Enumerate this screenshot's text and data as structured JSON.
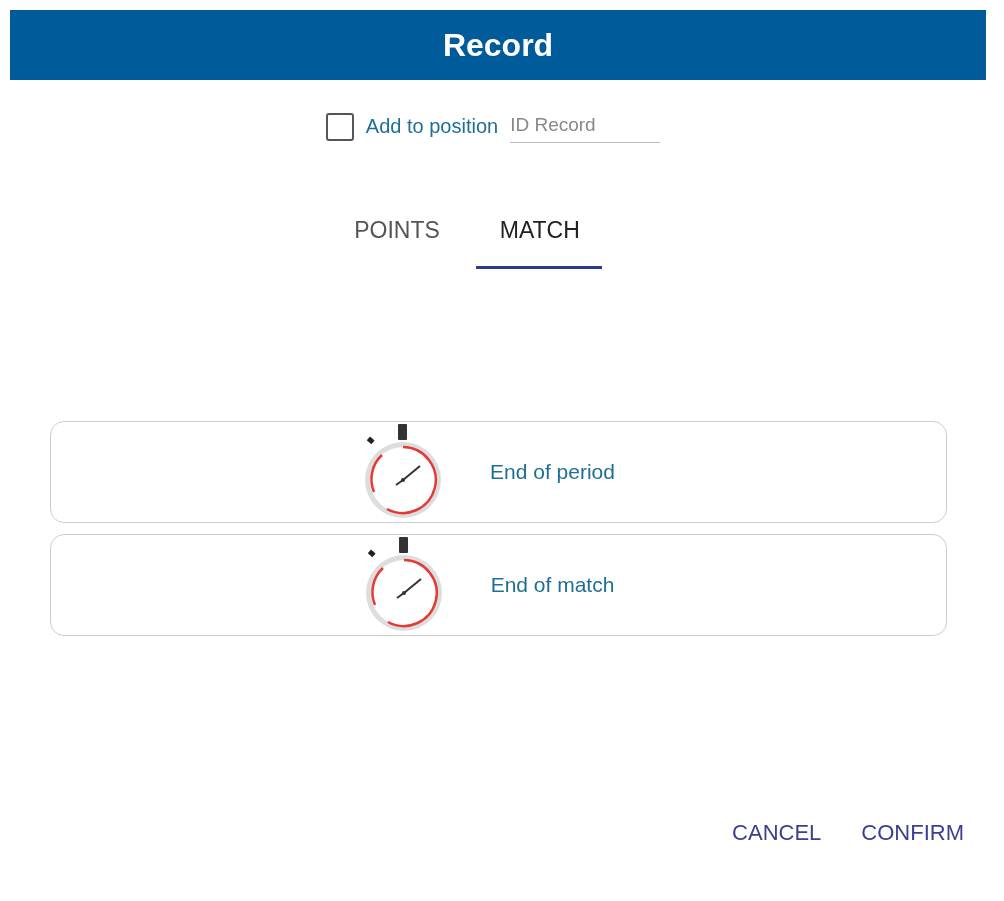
{
  "dialog": {
    "title": "Record"
  },
  "add_to_position": {
    "label": "Add to position",
    "checked": false
  },
  "id_field": {
    "placeholder": "ID Record"
  },
  "tabs": [
    {
      "label": "POINTS",
      "selected": false
    },
    {
      "label": "MATCH",
      "selected": true
    }
  ],
  "events": [
    {
      "label": "End of period"
    },
    {
      "label": "End of match"
    }
  ],
  "buttons": [
    "CANCEL",
    "CONFIRM"
  ]
}
